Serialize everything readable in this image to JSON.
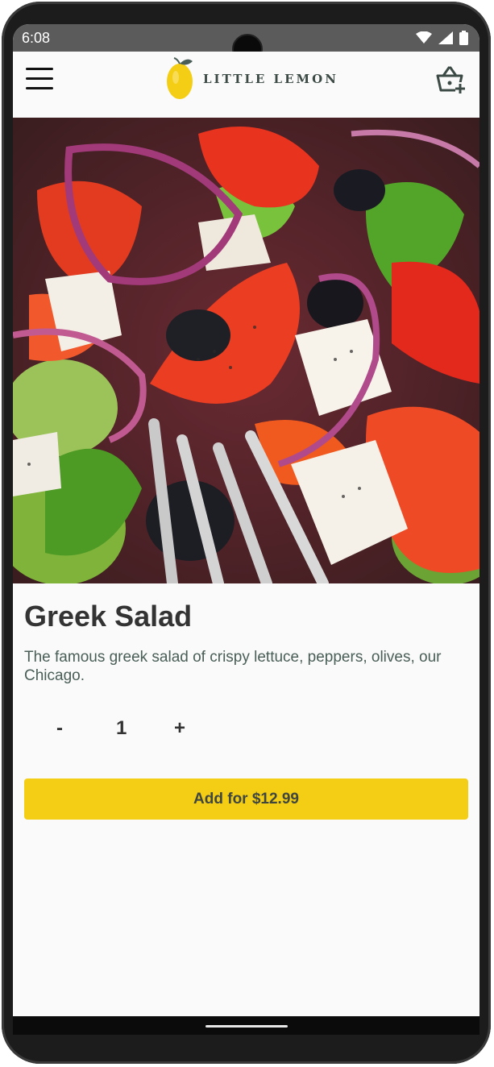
{
  "status_bar": {
    "time": "6:08",
    "icons": [
      "wifi-icon",
      "cellular-signal-icon",
      "battery-icon"
    ]
  },
  "header": {
    "logo_text": "LITTLE LEMON",
    "menu_icon": "hamburger-menu-icon",
    "cart_icon": "basket-add-icon"
  },
  "dish": {
    "image_alt": "greek salad photo",
    "title": "Greek Salad",
    "description": "The famous greek salad of crispy lettuce, peppers, olives, our Chicago."
  },
  "quantity": {
    "decrement_label": "-",
    "value": "1",
    "increment_label": "+"
  },
  "cta": {
    "add_label": "Add for $12.99"
  },
  "colors": {
    "accent_yellow": "#F4CE14",
    "brand_green": "#495E57",
    "title_text": "#333333",
    "status_bar_bg": "#5B5B5B"
  }
}
